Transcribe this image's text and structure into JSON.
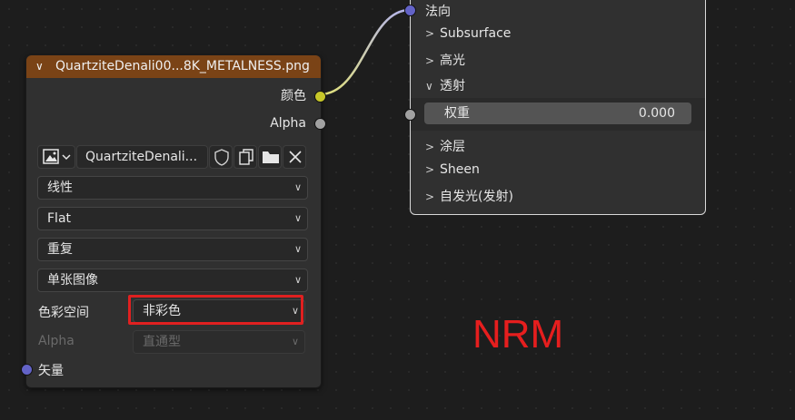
{
  "image_node": {
    "header_title": "QuartziteDenali00...8K_METALNESS.png",
    "outputs": [
      {
        "label": "颜色",
        "color": "#c7c729"
      },
      {
        "label": "Alpha",
        "color": "#a1a1a1"
      }
    ],
    "image_name": "QuartziteDenali...",
    "interpolation": "线性",
    "projection": "Flat",
    "extension": "重复",
    "source": "单张图像",
    "colorspace_label": "色彩空间",
    "colorspace_value": "非彩色",
    "alpha_label": "Alpha",
    "alpha_value": "直通型",
    "vector_input_label": "矢量",
    "vector_color": "#6363c7"
  },
  "bsdf_node": {
    "normal_label": "法向",
    "panels": [
      {
        "label": "Subsurface",
        "expanded": false
      },
      {
        "label": "高光",
        "expanded": false
      },
      {
        "label": "透射",
        "expanded": true
      }
    ],
    "weight_label": "权重",
    "weight_value": "0.000",
    "panels_after": [
      {
        "label": "涂层",
        "expanded": false
      },
      {
        "label": "Sheen",
        "expanded": false
      },
      {
        "label": "自发光(发射)",
        "expanded": false
      }
    ]
  },
  "annotation": {
    "text": "NRM",
    "color": "#e61e1e"
  }
}
